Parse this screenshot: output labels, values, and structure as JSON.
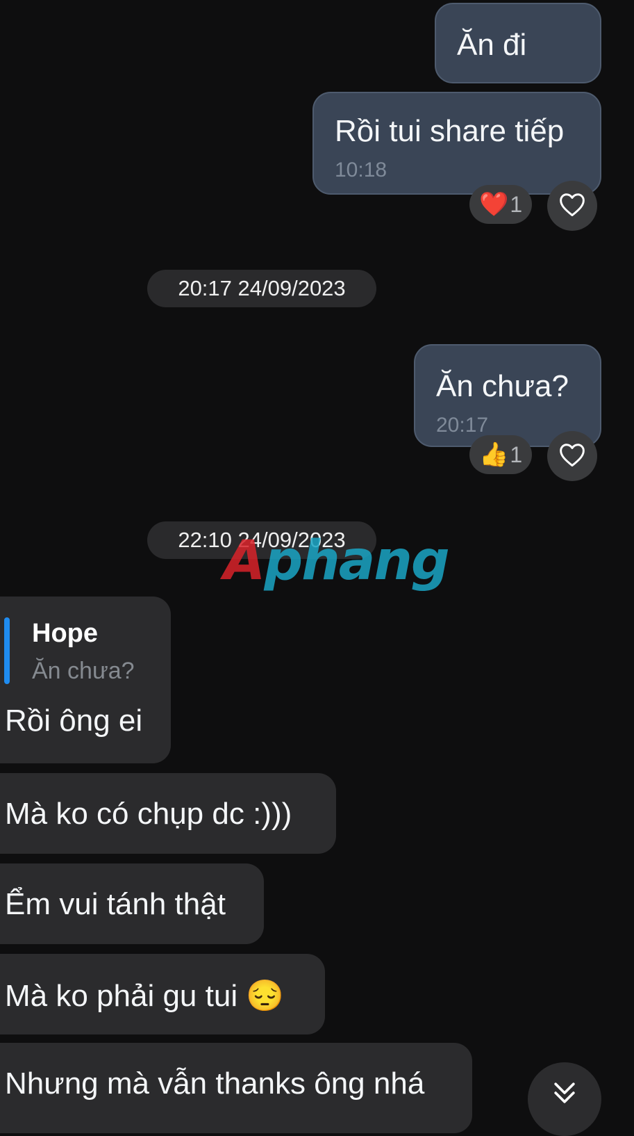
{
  "messages": {
    "m1": {
      "text": "Ăn đi"
    },
    "m2": {
      "text": "Rồi tui share tiếp",
      "time": "10:18",
      "reaction_emoji": "❤️",
      "reaction_count": "1"
    },
    "date1": "20:17 24/09/2023",
    "m3": {
      "text": "Ăn chưa?",
      "time": "20:17",
      "reaction_emoji": "👍",
      "reaction_count": "1"
    },
    "date2": "22:10 24/09/2023",
    "m4": {
      "reply_name": "Hope",
      "reply_text": "Ăn chưa?",
      "text": "Rồi ông ei"
    },
    "m5": {
      "text": "Mà ko có chụp dc :)))"
    },
    "m6": {
      "text": "Ểm vui tánh thật"
    },
    "m7": {
      "text": "Mà ko phải gu tui 😔"
    },
    "m8": {
      "text": "Nhưng mà vẫn thanks ông nhá"
    }
  },
  "watermark": {
    "part1": "A",
    "part2": "phang"
  },
  "icons": {
    "like": "heart-outline-icon",
    "scroll": "double-chevron-down-icon"
  },
  "colors": {
    "background": "#0e0e0f",
    "outgoing_bubble": "#3a4556",
    "incoming_bubble": "#2b2b2d",
    "reply_accent": "#1f8cf0"
  }
}
